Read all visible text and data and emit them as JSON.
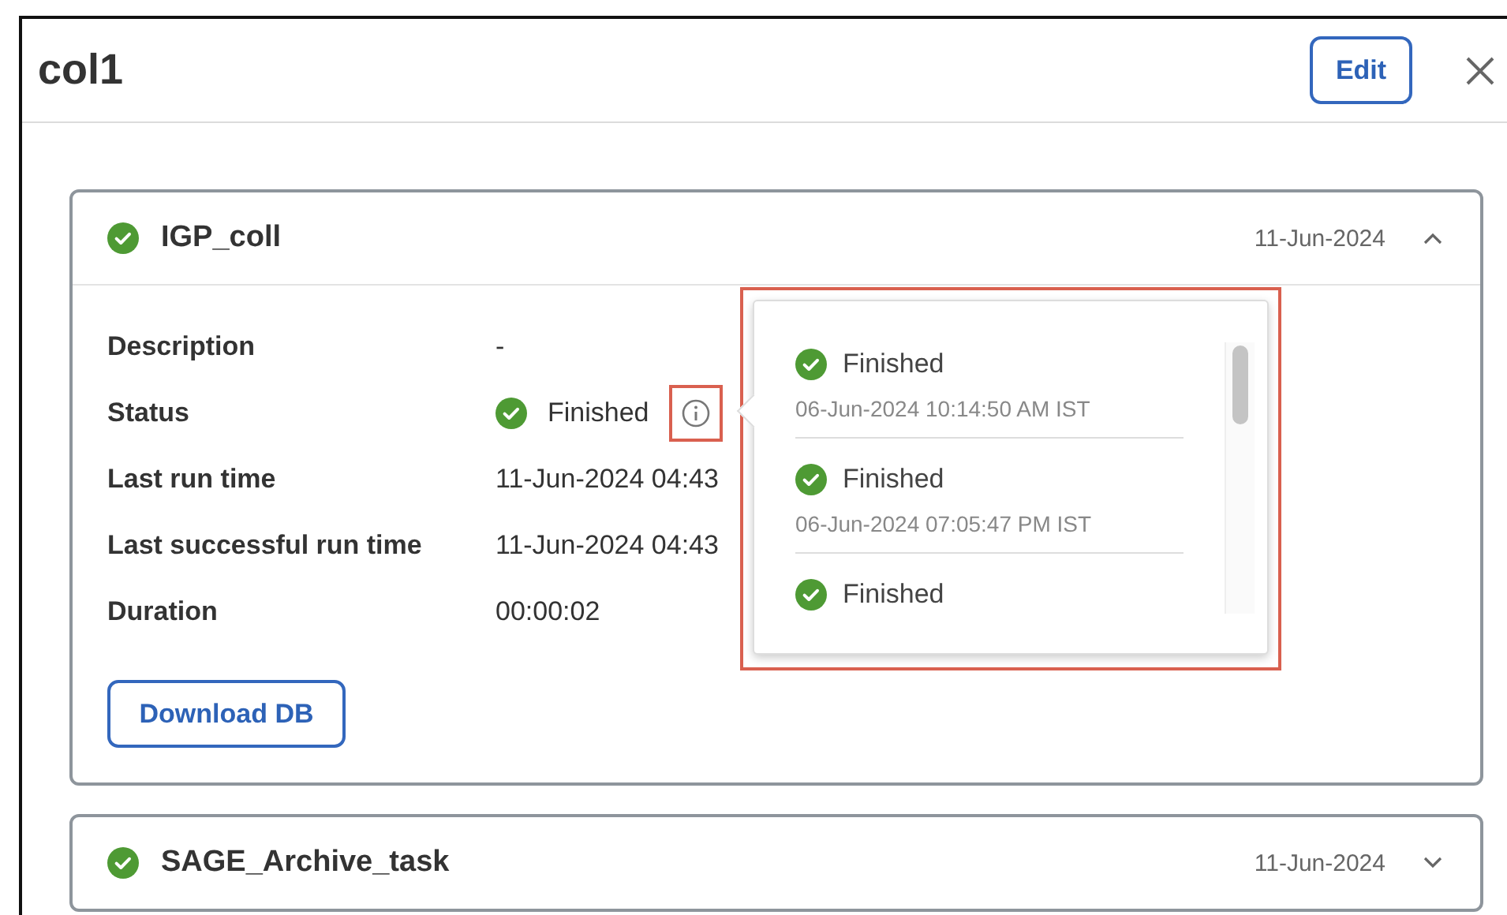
{
  "title": "col1",
  "edit_button": "Edit",
  "tasks": [
    {
      "name": "IGP_coll",
      "color": "#4e9a34",
      "date": "11-Jun-2024",
      "expanded": true,
      "details": [
        {
          "label": "Description",
          "value": "-"
        },
        {
          "label": "Status",
          "value": "Finished",
          "kind": "status"
        },
        {
          "label": "Last run time",
          "value": "11-Jun-2024 04:43"
        },
        {
          "label": "Last successful run time",
          "value": "11-Jun-2024 04:43"
        },
        {
          "label": "Duration",
          "value": "00:00:02"
        }
      ],
      "download_button": "Download DB",
      "history": [
        {
          "status": "Finished",
          "time": "06-Jun-2024 10:14:50 AM IST"
        },
        {
          "status": "Finished",
          "time": "06-Jun-2024 07:05:47 PM IST"
        },
        {
          "status": "Finished"
        }
      ]
    },
    {
      "name": "SAGE_Archive_task",
      "color": "#4e9a34",
      "date": "11-Jun-2024",
      "expanded": false
    }
  ]
}
